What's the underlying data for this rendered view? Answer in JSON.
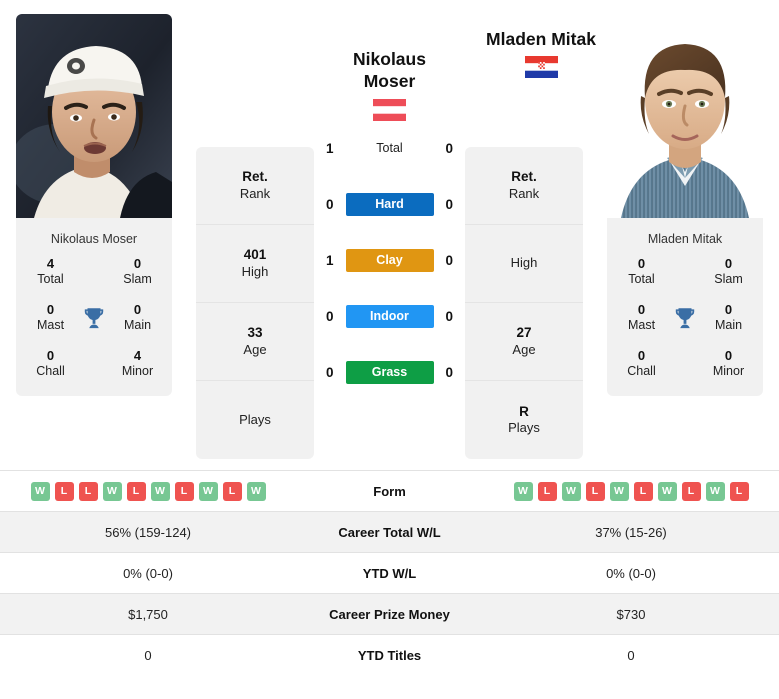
{
  "players": {
    "left": {
      "name_line1": "Nikolaus",
      "name_line2": "Moser",
      "card_name": "Nikolaus Moser",
      "country": "Austria",
      "flag_icon": "flag-austria",
      "photo_alt": "Nikolaus Moser portrait",
      "titles": {
        "total_value": "4",
        "total_label": "Total",
        "slam_value": "0",
        "slam_label": "Slam",
        "mast_value": "0",
        "mast_label": "Mast",
        "main_value": "0",
        "main_label": "Main",
        "chall_value": "0",
        "chall_label": "Chall",
        "minor_value": "4",
        "minor_label": "Minor"
      },
      "info": [
        {
          "value": "Ret.",
          "label": "Rank"
        },
        {
          "value": "401",
          "label": "High"
        },
        {
          "value": "33",
          "label": "Age"
        },
        {
          "value": "",
          "label": "Plays"
        }
      ],
      "surface_counts": {
        "total": "1",
        "hard": "0",
        "clay": "1",
        "indoor": "0",
        "grass": "0"
      },
      "form": [
        "W",
        "L",
        "L",
        "W",
        "L",
        "W",
        "L",
        "W",
        "L",
        "W"
      ],
      "career_total_wl": "56% (159-124)",
      "ytd_wl": "0% (0-0)",
      "career_prize_money": "$1,750",
      "ytd_titles": "0"
    },
    "right": {
      "name_line1": "Mladen Mitak",
      "name_line2": "",
      "card_name": "Mladen Mitak",
      "country": "Croatia",
      "flag_icon": "flag-croatia",
      "photo_alt": "Mladen Mitak portrait",
      "titles": {
        "total_value": "0",
        "total_label": "Total",
        "slam_value": "0",
        "slam_label": "Slam",
        "mast_value": "0",
        "mast_label": "Mast",
        "main_value": "0",
        "main_label": "Main",
        "chall_value": "0",
        "chall_label": "Chall",
        "minor_value": "0",
        "minor_label": "Minor"
      },
      "info": [
        {
          "value": "Ret.",
          "label": "Rank"
        },
        {
          "value": "",
          "label": "High"
        },
        {
          "value": "27",
          "label": "Age"
        },
        {
          "value": "R",
          "label": "Plays"
        }
      ],
      "surface_counts": {
        "total": "0",
        "hard": "0",
        "clay": "0",
        "indoor": "0",
        "grass": "0"
      },
      "form": [
        "W",
        "L",
        "W",
        "L",
        "W",
        "L",
        "W",
        "L",
        "W",
        "L"
      ],
      "career_total_wl": "37% (15-26)",
      "ytd_wl": "0% (0-0)",
      "career_prize_money": "$730",
      "ytd_titles": "0"
    }
  },
  "surfaces": [
    {
      "key": "total",
      "label": "Total",
      "color": "transparent",
      "text_color": "#222222"
    },
    {
      "key": "hard",
      "label": "Hard",
      "color": "#0b6cbf",
      "text_color": "#ffffff"
    },
    {
      "key": "clay",
      "label": "Clay",
      "color": "#e09612",
      "text_color": "#ffffff"
    },
    {
      "key": "indoor",
      "label": "Indoor",
      "color": "#2196f3",
      "text_color": "#ffffff"
    },
    {
      "key": "grass",
      "label": "Grass",
      "color": "#0e9e45",
      "text_color": "#ffffff"
    }
  ],
  "table_labels": {
    "form": "Form",
    "career_total_wl": "Career Total W/L",
    "ytd_wl": "YTD W/L",
    "career_prize_money": "Career Prize Money",
    "ytd_titles": "YTD Titles"
  },
  "icons": {
    "trophy": "trophy-icon",
    "win_badge": "W",
    "loss_badge": "L"
  },
  "colors": {
    "hard": "#0b6cbf",
    "clay": "#e09612",
    "indoor": "#2196f3",
    "grass": "#0e9e45",
    "win": "#77c793",
    "loss": "#ef5350",
    "trophy": "#3a6ea5",
    "card_bg": "#f1f1f1",
    "row_shade": "#f2f2f2"
  }
}
